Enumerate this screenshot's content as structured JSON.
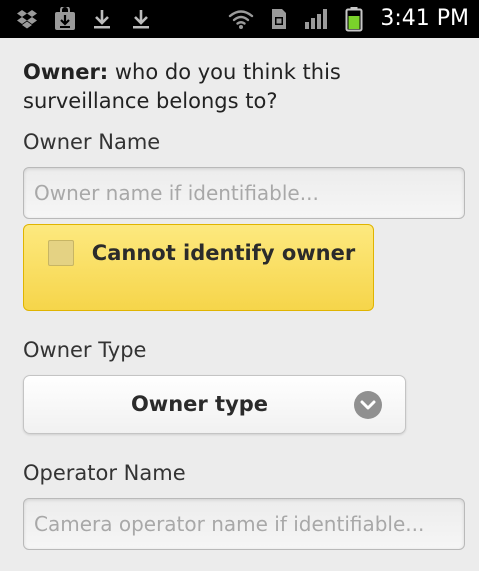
{
  "status_bar": {
    "time": "3:41 PM",
    "icons": [
      "dropbox-icon",
      "download-store-icon",
      "download-icon",
      "download-icon",
      "wifi-icon",
      "sim-icon",
      "signal-icon",
      "battery-icon"
    ]
  },
  "form": {
    "intro_bold": "Owner:",
    "intro_text": " who do you think this surveillance belongs to?",
    "owner_name_label": "Owner Name",
    "owner_name_placeholder": "Owner name if identifiable...",
    "owner_name_value": "",
    "cannot_identify_label": "Cannot identify owner",
    "cannot_identify_checked": false,
    "owner_type_label": "Owner Type",
    "owner_type_selected": "Owner type",
    "operator_name_label": "Operator Name",
    "operator_name_placeholder": "Camera operator name if identifiable...",
    "operator_name_value": ""
  },
  "colors": {
    "accent_button": "#f8dc5c",
    "background": "#ececec"
  }
}
